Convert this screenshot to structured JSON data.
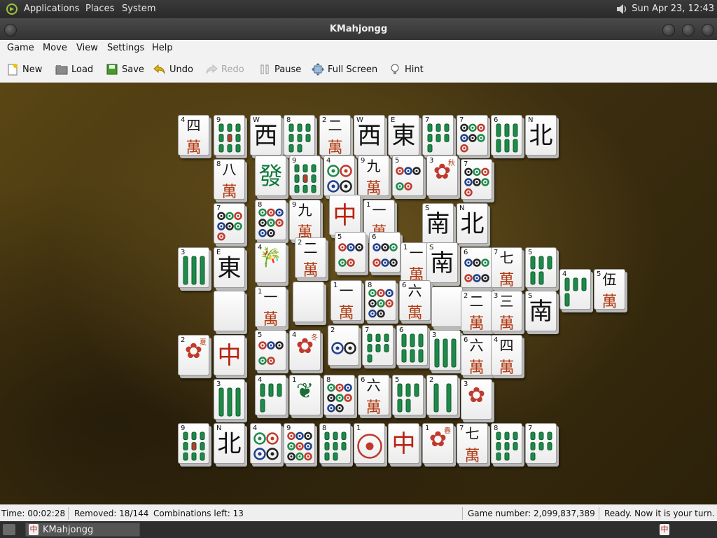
{
  "system_panel": {
    "menus": [
      "Applications",
      "Places",
      "System"
    ],
    "clock": "Sun Apr 23, 12:43"
  },
  "window": {
    "title": "KMahjongg"
  },
  "menubar": {
    "items": [
      "Game",
      "Move",
      "View",
      "Settings",
      "Help"
    ]
  },
  "toolbar": {
    "new": "New",
    "load": "Load",
    "save": "Save",
    "undo": "Undo",
    "redo": "Redo",
    "pause": "Pause",
    "fullscreen": "Full Screen",
    "hint": "Hint"
  },
  "status": {
    "time": "Time: 00:02:28",
    "removed": "Removed: 18/144",
    "combinations": "Combinations left: 13",
    "game_number": "Game number: 2,099,837,389",
    "message": "Ready. Now it is your turn."
  },
  "taskbar": {
    "task": "KMahjongg"
  },
  "colors": {
    "board": "#4a3a12",
    "tile_face": "#ffffff",
    "character_red": "#b23a12",
    "dragon_green": "#0d7a3a"
  },
  "tiles": [
    {
      "kind": "char",
      "num": "4",
      "glyph": "四"
    },
    {
      "kind": "bam",
      "num": "9"
    },
    {
      "kind": "wind",
      "num": "W",
      "glyph": "西"
    },
    {
      "kind": "bam",
      "num": "8"
    },
    {
      "kind": "char",
      "num": "2",
      "glyph": "二"
    },
    {
      "kind": "wind",
      "num": "W",
      "glyph": "西"
    },
    {
      "kind": "wind",
      "num": "E",
      "glyph": "東"
    },
    {
      "kind": "bam",
      "num": "7"
    },
    {
      "kind": "dot",
      "num": "7"
    },
    {
      "kind": "bam",
      "num": "6"
    },
    {
      "kind": "wind",
      "num": "N",
      "glyph": "北"
    },
    {
      "kind": "char",
      "num": "8",
      "glyph": "八"
    },
    {
      "kind": "green",
      "num": "",
      "glyph": "發"
    },
    {
      "kind": "bam",
      "num": "9"
    },
    {
      "kind": "dot",
      "num": "4"
    },
    {
      "kind": "char",
      "num": "9",
      "glyph": "九"
    },
    {
      "kind": "dot",
      "num": "5"
    },
    {
      "kind": "flower",
      "num": "3",
      "glyph": "秋"
    },
    {
      "kind": "dot",
      "num": "7"
    },
    {
      "kind": "dot",
      "num": "7"
    },
    {
      "kind": "dot",
      "num": "8"
    },
    {
      "kind": "char",
      "num": "9",
      "glyph": "九"
    },
    {
      "kind": "red",
      "num": "",
      "glyph": "中"
    },
    {
      "kind": "char",
      "num": "1",
      "glyph": "一"
    },
    {
      "kind": "wind",
      "num": "S",
      "glyph": "南"
    },
    {
      "kind": "wind",
      "num": "N",
      "glyph": "北"
    },
    {
      "kind": "bam",
      "num": "3"
    },
    {
      "kind": "wind",
      "num": "E",
      "glyph": "東"
    },
    {
      "kind": "bamboo",
      "num": "4"
    },
    {
      "kind": "char",
      "num": "2",
      "glyph": "二"
    },
    {
      "kind": "dot",
      "num": "5"
    },
    {
      "kind": "dot",
      "num": "6"
    },
    {
      "kind": "char",
      "num": "1",
      "glyph": "一"
    },
    {
      "kind": "wind",
      "num": "S",
      "glyph": "南"
    },
    {
      "kind": "dot",
      "num": "6"
    },
    {
      "kind": "char",
      "num": "7",
      "glyph": "七"
    },
    {
      "kind": "bam",
      "num": "5"
    },
    {
      "kind": "bam",
      "num": "4"
    },
    {
      "kind": "char",
      "num": "5",
      "glyph": "伍"
    },
    {
      "kind": "blank",
      "num": ""
    },
    {
      "kind": "char",
      "num": "1",
      "glyph": "一"
    },
    {
      "kind": "blank",
      "num": ""
    },
    {
      "kind": "char",
      "num": "1",
      "glyph": "一"
    },
    {
      "kind": "dot",
      "num": "8"
    },
    {
      "kind": "char",
      "num": "6",
      "glyph": "六"
    },
    {
      "kind": "blank",
      "num": ""
    },
    {
      "kind": "char",
      "num": "2",
      "glyph": "二"
    },
    {
      "kind": "char",
      "num": "3",
      "glyph": "三"
    },
    {
      "kind": "wind",
      "num": "S",
      "glyph": "南"
    },
    {
      "kind": "flower",
      "num": "2",
      "glyph": "夏"
    },
    {
      "kind": "red",
      "num": "",
      "glyph": "中"
    },
    {
      "kind": "dot",
      "num": "5"
    },
    {
      "kind": "flower",
      "num": "4",
      "glyph": "冬"
    },
    {
      "kind": "dot",
      "num": "2"
    },
    {
      "kind": "bam",
      "num": "7"
    },
    {
      "kind": "bam",
      "num": "6"
    },
    {
      "kind": "bam",
      "num": "3"
    },
    {
      "kind": "char",
      "num": "6",
      "glyph": "六"
    },
    {
      "kind": "char",
      "num": "4",
      "glyph": "四"
    },
    {
      "kind": "bam",
      "num": "3"
    },
    {
      "kind": "bam",
      "num": "4"
    },
    {
      "kind": "bird",
      "num": "1"
    },
    {
      "kind": "dot",
      "num": "8"
    },
    {
      "kind": "char",
      "num": "6",
      "glyph": "六"
    },
    {
      "kind": "bam",
      "num": "5"
    },
    {
      "kind": "bam",
      "num": "2"
    },
    {
      "kind": "flower",
      "num": "3",
      "glyph": ""
    },
    {
      "kind": "bam",
      "num": "9"
    },
    {
      "kind": "wind",
      "num": "N",
      "glyph": "北"
    },
    {
      "kind": "dot",
      "num": "4"
    },
    {
      "kind": "dot",
      "num": "9"
    },
    {
      "kind": "bam",
      "num": "8"
    },
    {
      "kind": "dot",
      "num": "1"
    },
    {
      "kind": "red",
      "num": "",
      "glyph": "中"
    },
    {
      "kind": "flower",
      "num": "1",
      "glyph": "春"
    },
    {
      "kind": "char",
      "num": "7",
      "glyph": "七"
    },
    {
      "kind": "bam",
      "num": "8"
    },
    {
      "kind": "bam",
      "num": "7"
    }
  ]
}
